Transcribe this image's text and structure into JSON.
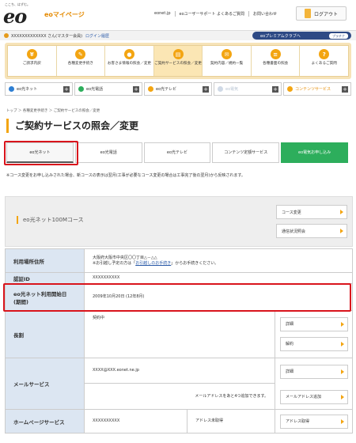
{
  "header": {
    "tagline": "ここち、はずむ。",
    "logo": "eo",
    "service": "eoマイページ",
    "links": [
      "eonet.jp",
      "eoユーザーサポート よくあるご質問",
      "お問い合わせ"
    ],
    "logout": "ログアウト"
  },
  "userbar": {
    "name": "XXXXXXXXXXXXX さん(マスター会員)",
    "history": "ログイン履歴",
    "premium": "eoプレミアムクラブへ",
    "premium_badge": "プラチナ"
  },
  "nav": [
    {
      "icon": "yen-icon",
      "glyph": "¥",
      "label": "ご請求内訳"
    },
    {
      "icon": "pencil-icon",
      "glyph": "✎",
      "label": "各種変更手続き"
    },
    {
      "icon": "person-icon",
      "glyph": "●",
      "label": "お客さま情報の照会／変更"
    },
    {
      "icon": "document-icon",
      "glyph": "▤",
      "label": "ご契約サービスの照会／変更"
    },
    {
      "icon": "contract-icon",
      "glyph": "✉",
      "label": "契約内容／規約一覧"
    },
    {
      "icon": "document-stack-icon",
      "glyph": "≡",
      "label": "各種書面の照会"
    },
    {
      "icon": "question-icon",
      "glyph": "?",
      "label": "よくあるご質問"
    }
  ],
  "categories": [
    {
      "label": "eo光ネット",
      "color": "#2e7fd3"
    },
    {
      "label": "eo光電話",
      "color": "#2dae5c"
    },
    {
      "label": "eo光テレビ",
      "color": "#f3a512"
    },
    {
      "label": "eo電気",
      "color": "#cfd9e6"
    },
    {
      "label": "コンテンツサービス",
      "color": "#f3a512"
    }
  ],
  "breadcrumb": "トップ ＞ 各種変更手続き ＞ ご契約サービスの照会／変更",
  "page_title": "ご契約サービスの照会／変更",
  "tabs": [
    "eo光ネット",
    "eo光電話",
    "eo光テレビ",
    "コンテンツ定額サービス",
    "eo電気お申し込み"
  ],
  "note": "※コース変更をお申し込みされた場合、新コースの表示は翌月(工事が必要なコース変更の場合は工事完了後の翌月)から反映されます。",
  "course": {
    "title": "eo光ネット100Mコース",
    "change_btn": "コース変更",
    "status_btn": "通信状況照会"
  },
  "table": {
    "address_label": "利用場所住所",
    "address_value": "大阪府大阪市中央区〇〇丁目△－△△",
    "address_note_pre": "※お引越し予定の方は「",
    "address_note_link": "お引越しのお手続き",
    "address_note_post": "」からお手続きください。",
    "id_label": "認証ID",
    "id_value": "XXXXXXXXXX",
    "start_label_1": "eo光ネット利用開始日",
    "start_label_2": "(期間)",
    "start_value": "2009年10月20日 (12年8月)",
    "term_label": "長割",
    "term_value": "契約中",
    "term_detail": "詳細",
    "term_cancel": "解約",
    "mail_label": "メールサービス",
    "mail_value": "XXXX@XXX.eonet.ne.jp",
    "mail_detail": "詳細",
    "mail_note": "メールアドレスをあと4つ追加できます。",
    "mail_add": "メールアドレス追加",
    "hp_label": "ホームページサービス",
    "hp_value": "XXXXXXXXXX",
    "hp_status": "アドレス未取得",
    "hp_btn": "アドレス取得"
  }
}
